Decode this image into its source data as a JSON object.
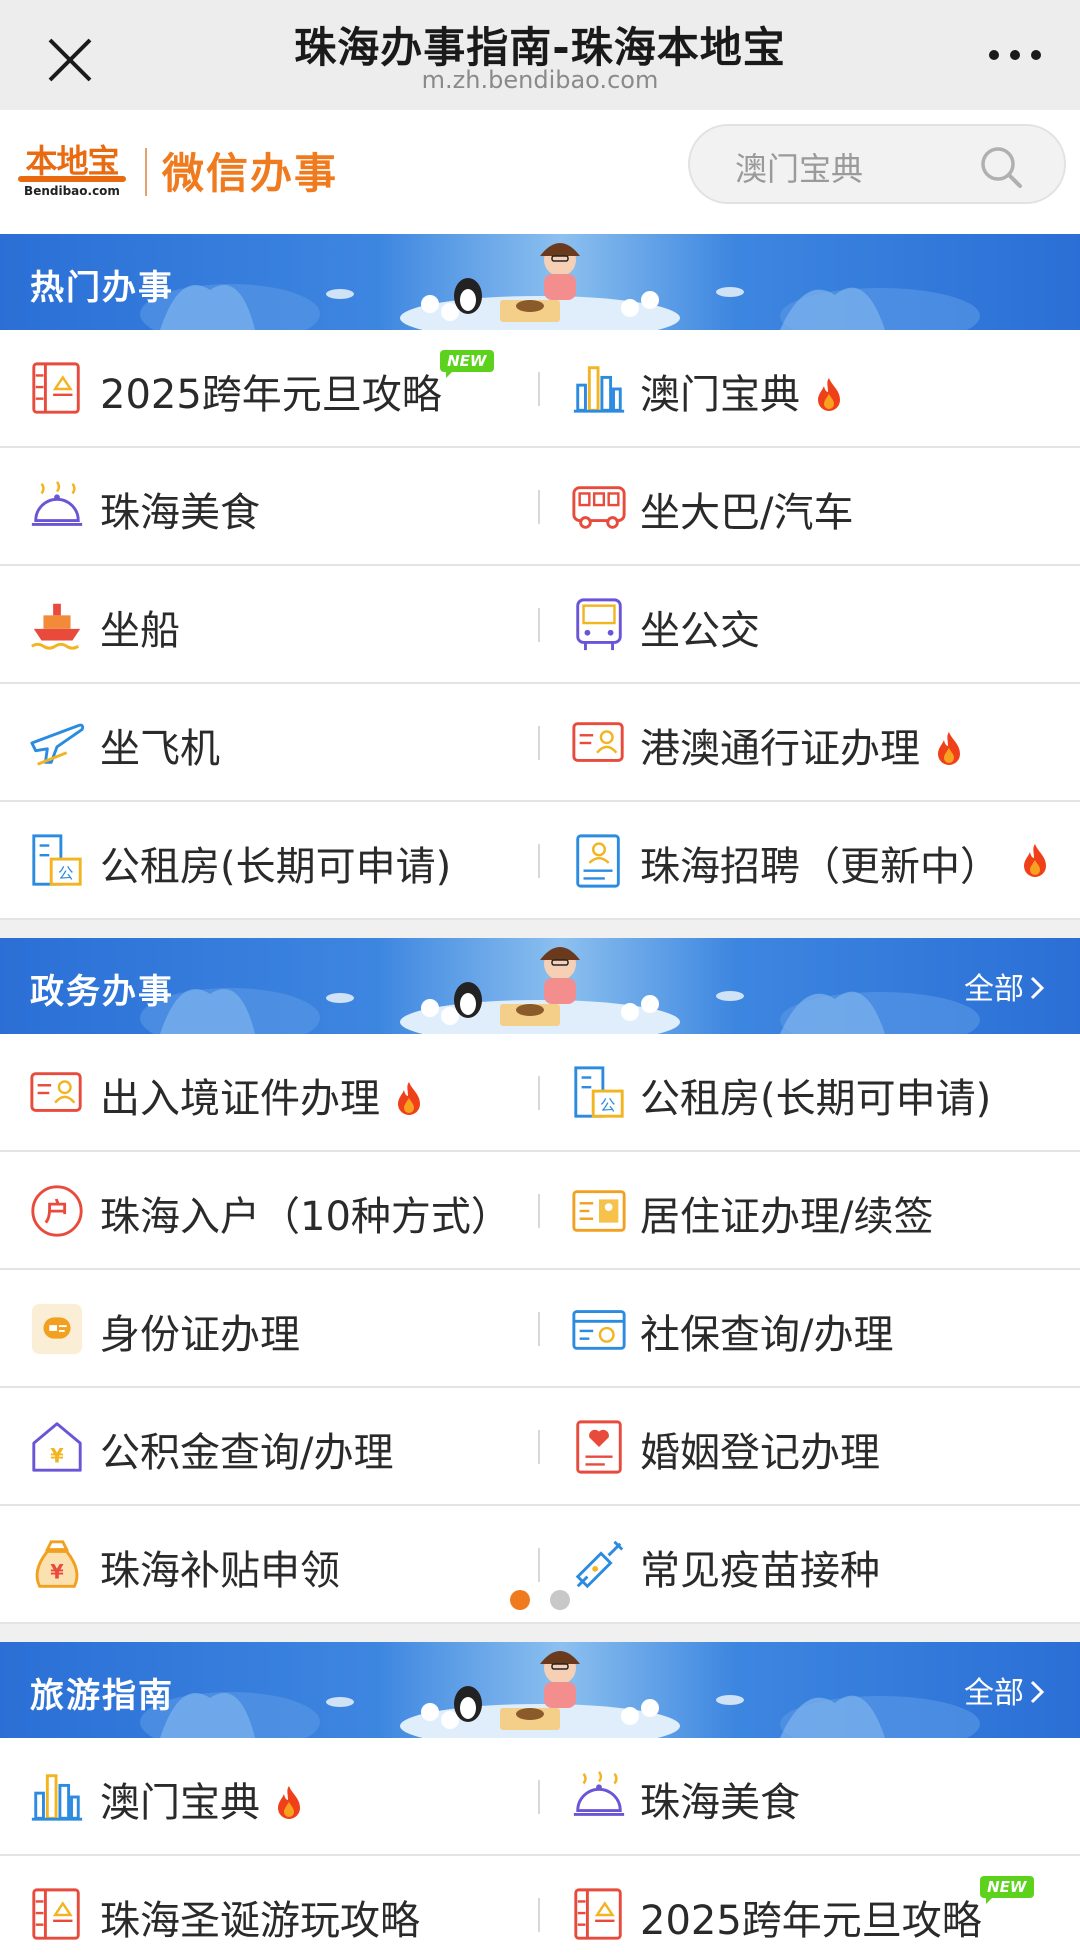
{
  "wechat": {
    "title": "珠海办事指南-珠海本地宝",
    "url": "m.zh.bendibao.com",
    "close_icon": "close-icon",
    "more_icon": "more-dots-icon"
  },
  "header": {
    "logo_text": "本地宝",
    "logo_domain": "Bendibao.com",
    "brand": "微信办事",
    "search_placeholder": "澳门宝典"
  },
  "sections": {
    "hot": {
      "title": "热门办事",
      "rows": [
        {
          "left": {
            "label": "2025跨年元旦攻略",
            "icon": "calendar-building-icon",
            "badge": "NEW"
          },
          "right": {
            "label": "澳门宝典",
            "icon": "city-skyline-icon",
            "hot": true
          }
        },
        {
          "left": {
            "label": "珠海美食",
            "icon": "food-dish-icon"
          },
          "right": {
            "label": "坐大巴/汽车",
            "icon": "bus-icon"
          }
        },
        {
          "left": {
            "label": "坐船",
            "icon": "ship-icon"
          },
          "right": {
            "label": "坐公交",
            "icon": "city-bus-icon"
          }
        },
        {
          "left": {
            "label": "坐飞机",
            "icon": "airplane-icon"
          },
          "right": {
            "label": "港澳通行证办理",
            "icon": "id-card-icon",
            "hot": true
          }
        },
        {
          "left": {
            "label": "公租房(长期可申请)",
            "icon": "public-housing-icon"
          },
          "right": {
            "label": "珠海招聘（更新中）",
            "icon": "resume-icon",
            "hot": true
          }
        }
      ]
    },
    "gov": {
      "title": "政务办事",
      "more": "全部",
      "rows": [
        {
          "left": {
            "label": "出入境证件办理",
            "icon": "id-card-icon",
            "hot": true
          },
          "right": {
            "label": "公租房(长期可申请)",
            "icon": "public-housing-icon"
          }
        },
        {
          "left": {
            "label": "珠海入户（10种方式）",
            "icon": "hukou-icon"
          },
          "right": {
            "label": "居住证办理/续签",
            "icon": "residence-card-icon"
          }
        },
        {
          "left": {
            "label": "身份证办理",
            "icon": "identity-card-icon"
          },
          "right": {
            "label": "社保查询/办理",
            "icon": "social-security-card-icon"
          }
        },
        {
          "left": {
            "label": "公积金查询/办理",
            "icon": "housing-fund-icon"
          },
          "right": {
            "label": "婚姻登记办理",
            "icon": "marriage-heart-icon"
          }
        },
        {
          "left": {
            "label": "珠海补贴申领",
            "icon": "money-bag-icon"
          },
          "right": {
            "label": "常见疫苗接种",
            "icon": "syringe-icon"
          }
        }
      ],
      "pager": {
        "pages": 2,
        "active": 1
      }
    },
    "travel": {
      "title": "旅游指南",
      "more": "全部",
      "rows": [
        {
          "left": {
            "label": "澳门宝典",
            "icon": "city-skyline-icon",
            "hot": true
          },
          "right": {
            "label": "珠海美食",
            "icon": "food-dish-icon"
          }
        },
        {
          "left": {
            "label": "珠海圣诞游玩攻略",
            "icon": "calendar-building-icon"
          },
          "right": {
            "label": "2025跨年元旦攻略",
            "icon": "calendar-building-icon",
            "badge": "NEW"
          }
        }
      ]
    }
  },
  "colors": {
    "brand_orange": "#f07a1e",
    "banner_blue": "#2b6fd6",
    "fire_red": "#f0401a",
    "new_green": "#5dd21c",
    "pager_active": "#f07a1e",
    "pager_inactive": "#c8c8c8"
  }
}
